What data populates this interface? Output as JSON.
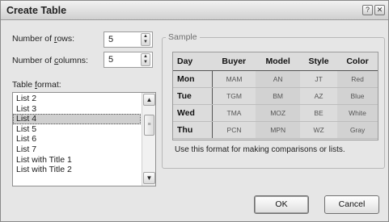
{
  "window": {
    "title": "Create Table",
    "help_glyph": "?",
    "close_glyph": "✕"
  },
  "fields": {
    "rows_label_pre": "Number of ",
    "rows_label_key": "r",
    "rows_label_post": "ows:",
    "rows_value": "5",
    "columns_label_pre": "Number of ",
    "columns_label_key": "c",
    "columns_label_post": "olumns:",
    "columns_value": "5"
  },
  "table_format": {
    "label_pre": "Table ",
    "label_key": "f",
    "label_post": "ormat:",
    "items": [
      "List 2",
      "List 3",
      "List 4",
      "List 5",
      "List 6",
      "List 7",
      "List with Title 1",
      "List with Title 2"
    ],
    "selected": "List 4"
  },
  "sample": {
    "legend": "Sample",
    "headers": [
      "Day",
      "Buyer",
      "Model",
      "Style",
      "Color"
    ],
    "rows": [
      [
        "Mon",
        "MAM",
        "AN",
        "JT",
        "Red"
      ],
      [
        "Tue",
        "TGM",
        "BM",
        "AZ",
        "Blue"
      ],
      [
        "Wed",
        "TMA",
        "MOZ",
        "BE",
        "White"
      ],
      [
        "Thu",
        "PCN",
        "MPN",
        "WZ",
        "Gray"
      ]
    ],
    "hint": "Use this format for making comparisons or lists."
  },
  "buttons": {
    "ok": "OK",
    "cancel": "Cancel"
  },
  "colors": {
    "dialog_bg": "#e6e6e6",
    "selection": "#cfcfcf",
    "preview_bg": "#dcdcdc"
  }
}
